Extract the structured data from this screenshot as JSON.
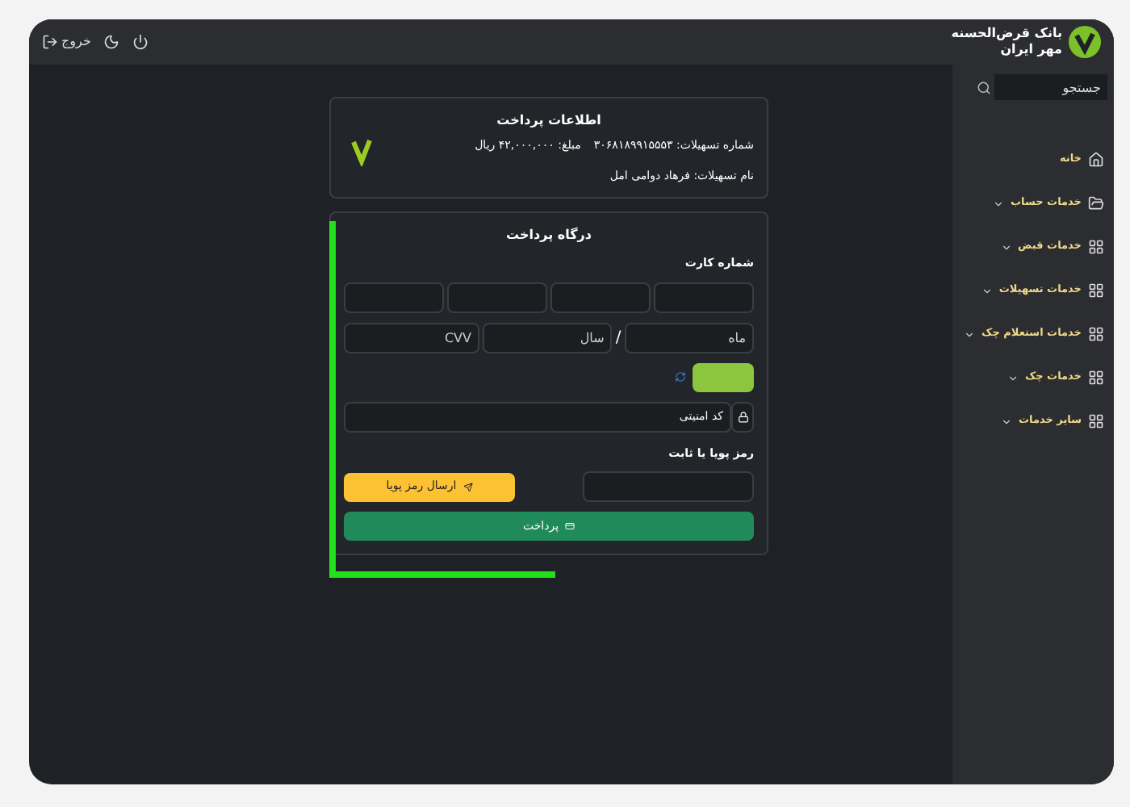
{
  "header": {
    "bank_name": "بانک قرض‌الحسنه",
    "bank_name_line2": "مهر ایران",
    "top_actions": [
      {
        "kind": "exit",
        "label": "خروج"
      },
      {
        "kind": "theme"
      },
      {
        "kind": "power"
      }
    ]
  },
  "sidebar": {
    "search": {
      "placeholder": "جستجو"
    },
    "items": [
      {
        "label": "خانه",
        "kind": "home",
        "expandable": false
      },
      {
        "label": "خدمات حساب",
        "kind": "account",
        "expandable": true
      },
      {
        "label": "خدمات قبض",
        "kind": "service",
        "expandable": true
      },
      {
        "label": "خدمات تسهیلات",
        "kind": "service",
        "expandable": true
      },
      {
        "label": "خدمات استعلام چک",
        "kind": "service",
        "expandable": true
      },
      {
        "label": "خدمات چک",
        "kind": "service",
        "expandable": true
      },
      {
        "label": "سایر خدمات",
        "kind": "service",
        "expandable": true
      }
    ]
  },
  "payment_info": {
    "title": "اطلاعات پرداخت",
    "facility_number": "شماره تسهیلات: ۳۰۶۸۱۸۹۹۱۵۵۵۳",
    "amount": "مبلغ: ۴۲,۰۰۰,۰۰۰ ریال",
    "facility_name": "نام تسهیلات: فرهاد دوامی امل"
  },
  "gateway": {
    "title": "درگاه پرداخت",
    "card_label": "شماره کارت",
    "expiry": {
      "month_placeholder": "ماه",
      "separator": "/",
      "year_placeholder": "سال",
      "cvv_placeholder": "CVV"
    },
    "captcha": {
      "placeholder": "کد امنیتی"
    },
    "password_label": "رمز پویا یا ثابت",
    "send_button": "ارسال رمز پویا",
    "pay_button": "پرداخت"
  }
}
